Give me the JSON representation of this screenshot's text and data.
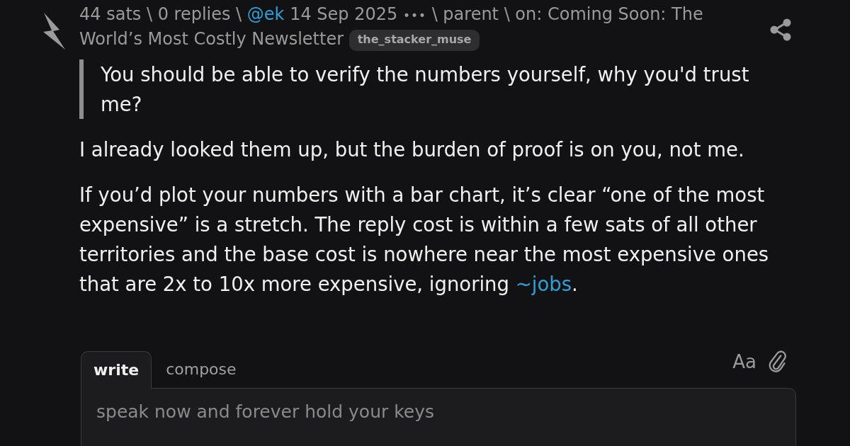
{
  "meta": [
    {
      "kind": "text",
      "text": "44 sats \\ 0 replies \\"
    },
    {
      "kind": "link",
      "text": "@ek"
    },
    {
      "kind": "text",
      "text": "14 Sep 2025"
    },
    {
      "kind": "menu",
      "text": "•••"
    },
    {
      "kind": "text",
      "text": "\\ parent \\ on: Coming Soon: The"
    },
    {
      "kind": "text",
      "text": "World’s Most Costly Newsletter"
    },
    {
      "kind": "tag",
      "text": "the_stacker_muse"
    }
  ],
  "body": [
    {
      "kind": "quote",
      "segments": [
        {
          "kind": "text",
          "text": "You should be able to verify the numbers yourself, why you'd trust me?"
        }
      ]
    },
    {
      "kind": "paragraph",
      "segments": [
        {
          "kind": "text",
          "text": "I already looked them up, but the burden of proof is on you, not me."
        }
      ]
    },
    {
      "kind": "paragraph",
      "segments": [
        {
          "kind": "text",
          "text": "If you’d plot your numbers with a bar chart, it’s clear “one of the most expensive” is a stretch. The reply cost is within a few sats of all other territories and the base cost is nowhere near the most expensive ones that are 2x to 10x more expensive, ignoring"
        },
        {
          "kind": "link",
          "text": "~jobs"
        },
        {
          "kind": "text",
          "text": "."
        }
      ]
    }
  ],
  "editor": {
    "tabs": [
      {
        "label": "write",
        "selected": true
      },
      {
        "label": "compose",
        "selected": false
      }
    ],
    "format_toggle": "Aa",
    "placeholder": "speak now and forever hold your keys"
  }
}
